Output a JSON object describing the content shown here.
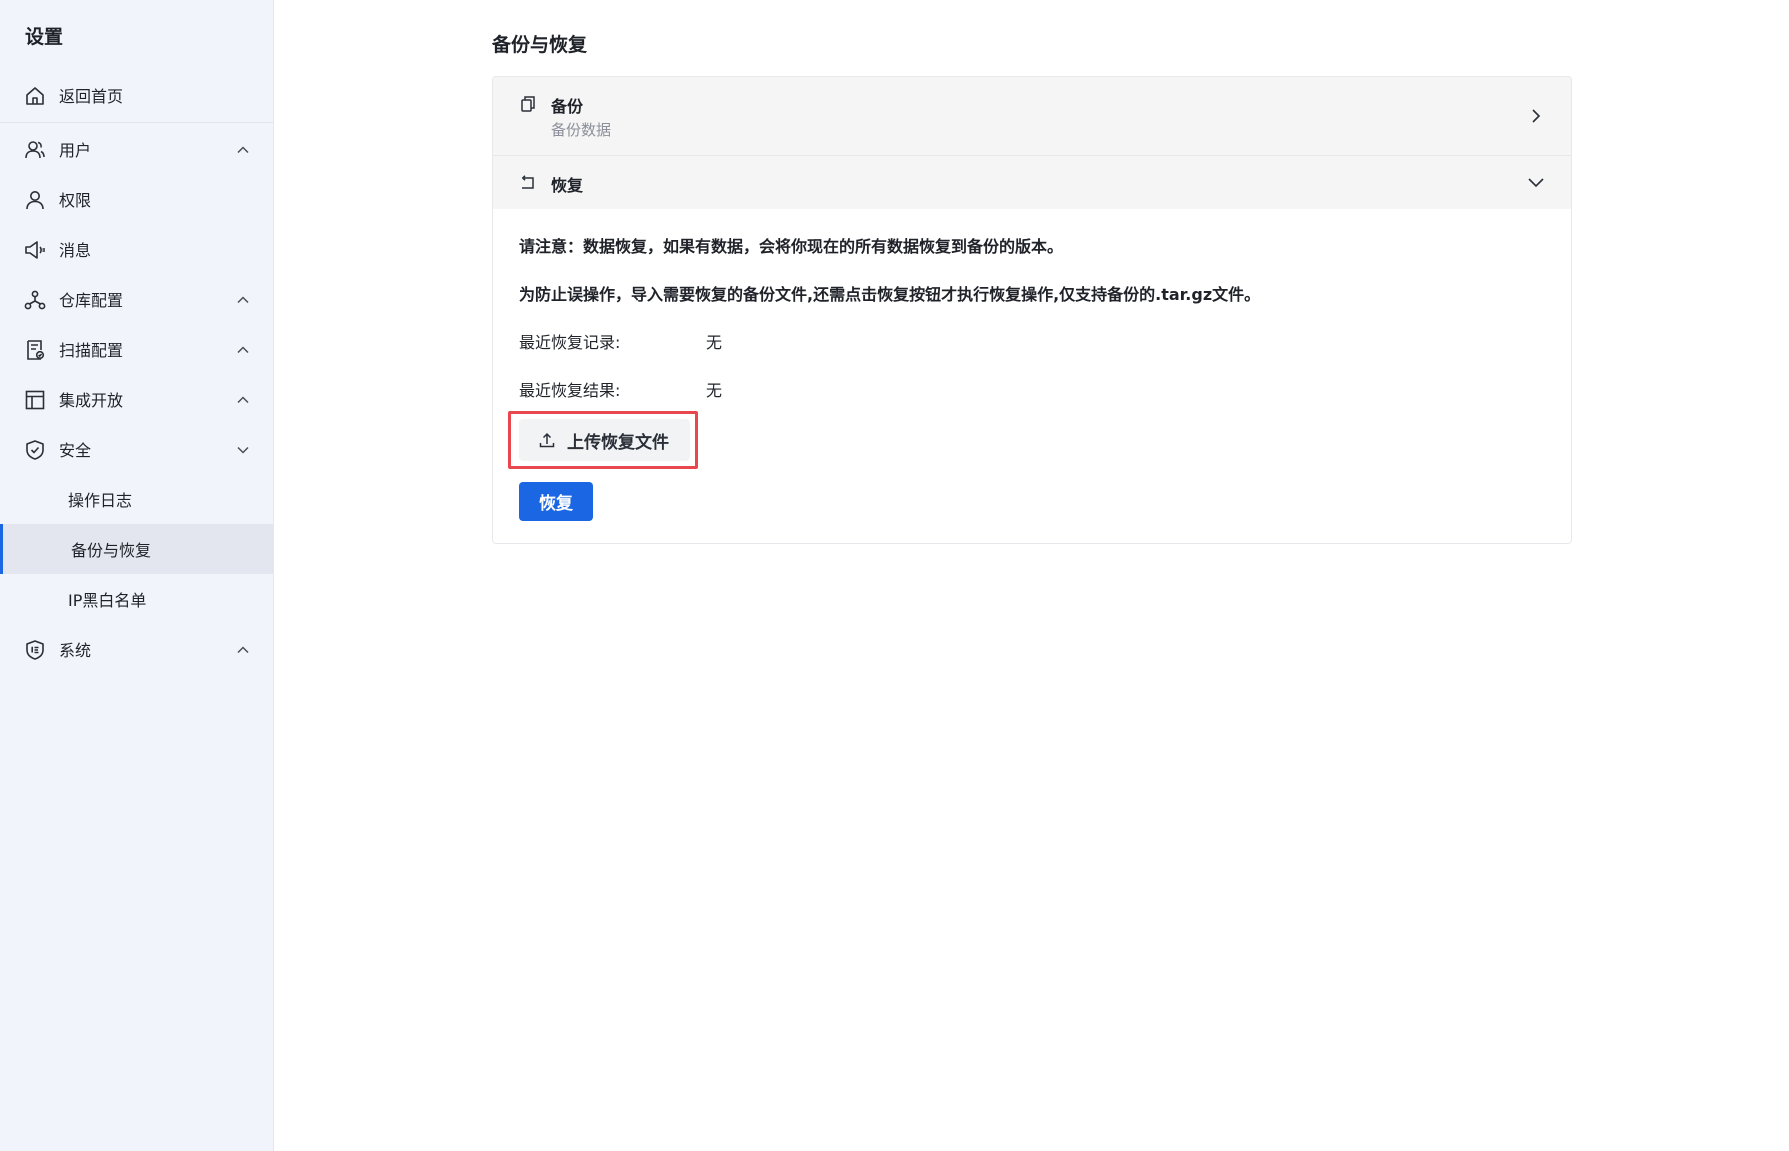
{
  "sidebar": {
    "title": "设置",
    "items": [
      {
        "label": "返回首页",
        "icon": "home-icon"
      },
      {
        "label": "用户",
        "icon": "users-icon",
        "chevron": "up"
      },
      {
        "label": "权限",
        "icon": "user-icon"
      },
      {
        "label": "消息",
        "icon": "megaphone-icon"
      },
      {
        "label": "仓库配置",
        "icon": "repository-icon",
        "chevron": "up"
      },
      {
        "label": "扫描配置",
        "icon": "scan-document-icon",
        "chevron": "up"
      },
      {
        "label": "集成开放",
        "icon": "layout-icon",
        "chevron": "up"
      },
      {
        "label": "安全",
        "icon": "shield-check-icon",
        "chevron": "down"
      },
      {
        "label": "操作日志",
        "sub": true
      },
      {
        "label": "备份与恢复",
        "sub": true,
        "active": true
      },
      {
        "label": "IP黑白名单",
        "sub": true
      },
      {
        "label": "系统",
        "icon": "system-shield-icon",
        "chevron": "up"
      }
    ]
  },
  "main": {
    "title": "备份与恢复",
    "backup": {
      "title": "备份",
      "subtitle": "备份数据",
      "icon": "copy-icon"
    },
    "restore": {
      "title": "恢复",
      "icon": "undo-icon",
      "notice1": "请注意：数据恢复，如果有数据，会将你现在的所有数据恢复到备份的版本。",
      "notice2": "为防止误操作，导入需要恢复的备份文件,还需点击恢复按钮才执行恢复操作,仅支持备份的.tar.gz文件。",
      "last_record_label": "最近恢复记录:",
      "last_record_value": "无",
      "last_result_label": "最近恢复结果:",
      "last_result_value": "无",
      "upload_label": "上传恢复文件",
      "restore_button": "恢复"
    }
  },
  "colors": {
    "primary": "#1a66e3",
    "sidebar_bg": "#f2f4fb",
    "highlight_border": "#e8484d"
  }
}
